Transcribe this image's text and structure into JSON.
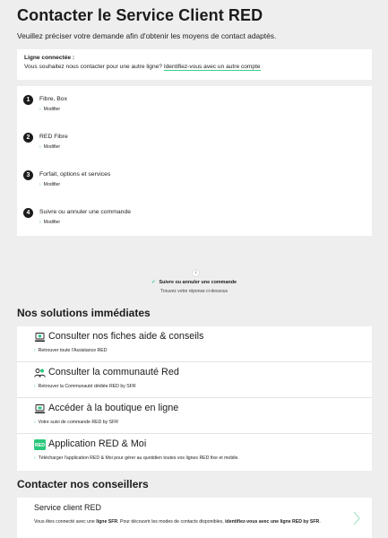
{
  "page": {
    "title": "Contacter le Service Client RED",
    "intro": "Veuillez préciser votre demande afin d'obtenir les moyens de contact adaptés."
  },
  "connected": {
    "label": "Ligne connectée :",
    "question": "Vous souhaitez nous contacter pour une autre ligne?",
    "link": "Identifiez-vous avec un autre compte"
  },
  "steps": [
    {
      "num": "1",
      "title": "Fibre, Box",
      "modify": "Modifier"
    },
    {
      "num": "2",
      "title": "RED Fibre",
      "modify": "Modifier"
    },
    {
      "num": "3",
      "title": "Forfait, options et services",
      "modify": "Modifier"
    },
    {
      "num": "4",
      "title": "Suivre ou annuler une commande",
      "modify": "Modifier"
    }
  ],
  "selection": {
    "arrow": "↓",
    "selected": "Suivre ou annuler une commande",
    "hint": "Trouvez votre réponse ci-dessous"
  },
  "solutions": {
    "heading": "Nos solutions immédiates",
    "items": [
      {
        "icon": "laptop-help-icon",
        "title": "Consulter nos fiches aide & conseils",
        "sub": "Retrouver toute l'Assistance RED"
      },
      {
        "icon": "community-icon",
        "title": "Consulter la communauté Red",
        "sub": "Retrouver la Communauté dédiée RED by SFR"
      },
      {
        "icon": "shop-laptop-icon",
        "title": "Accéder à la boutique en ligne",
        "sub": "Votre suivi de commande RED by SFR"
      },
      {
        "icon": "red-app-icon",
        "title": "Application RED & Moi",
        "sub": "Télécharger l'application RED & Moi pour gérer au quotidien toutes vos lignes RED fixe et mobile.",
        "badge": "RED"
      }
    ]
  },
  "advisors": {
    "heading": "Contacter nos conseillers",
    "title": "Service client RED",
    "text_pre": "Vous êtes connecté avec une ",
    "text_line": "ligne SFR",
    "text_mid": ". Pour découvrir les modes de contacts disponibles, ",
    "text_link": "identifiez-vous avec une ligne RED by SFR",
    "text_end": "."
  },
  "colors": {
    "accent": "#2bc77c",
    "dark": "#1b1b1b",
    "background": "#eeeeee"
  }
}
